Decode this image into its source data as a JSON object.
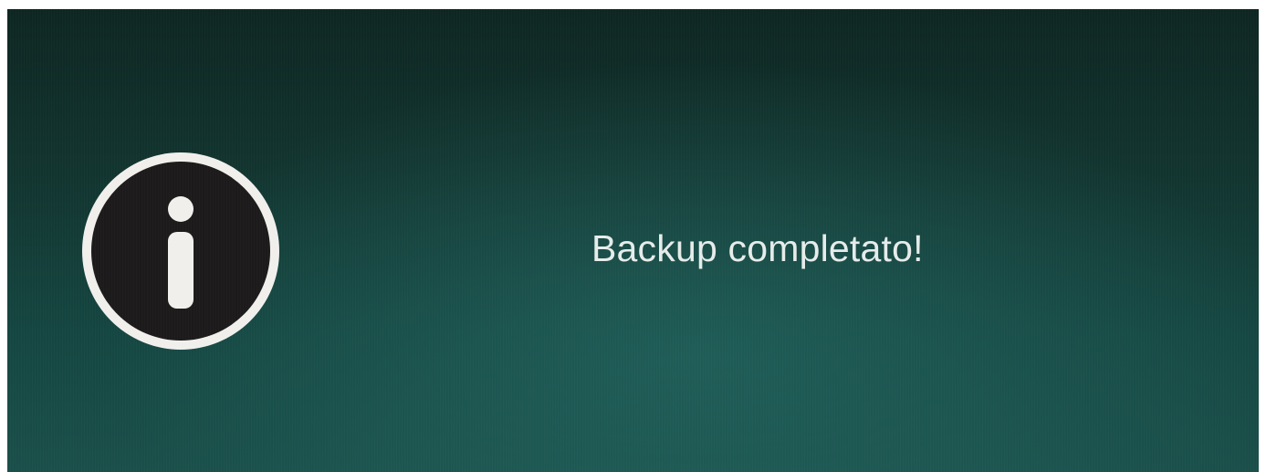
{
  "dialog": {
    "icon": "info-icon",
    "message": "Backup completato!"
  },
  "colors": {
    "background_top": "#0e2622",
    "background_bottom": "#1a4f4a",
    "icon_fill": "#1c1a1a",
    "icon_ring": "#f1efec",
    "text": "#e6ecea"
  }
}
